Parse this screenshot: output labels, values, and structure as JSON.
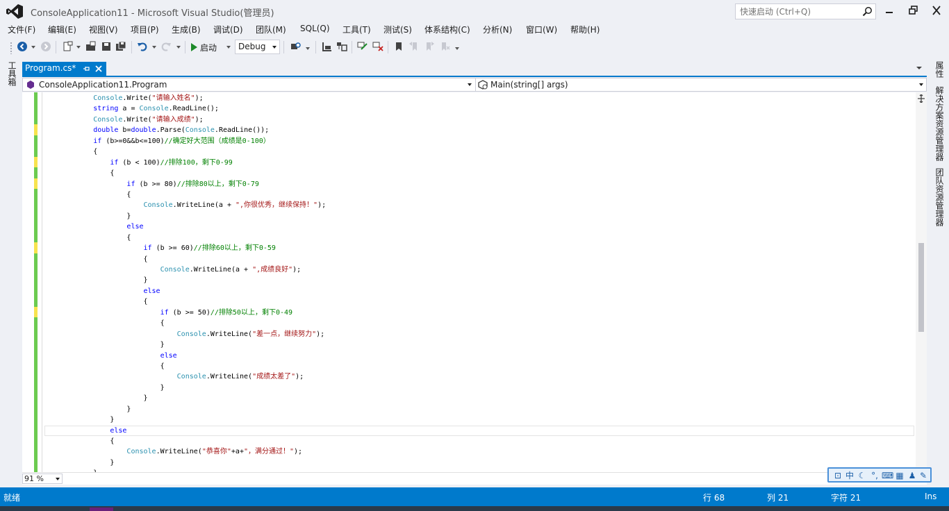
{
  "window": {
    "title": "ConsoleApplication11 - Microsoft Visual Studio(管理员)",
    "quick_launch_placeholder": "快速启动 (Ctrl+Q)"
  },
  "menu": [
    "文件(F)",
    "编辑(E)",
    "视图(V)",
    "项目(P)",
    "生成(B)",
    "调试(D)",
    "团队(M)",
    "SQL(Q)",
    "工具(T)",
    "测试(S)",
    "体系结构(C)",
    "分析(N)",
    "窗口(W)",
    "帮助(H)"
  ],
  "toolbar": {
    "start_label": "启动",
    "config_value": "Debug"
  },
  "left_panel": {
    "toolbox_label": "工具箱"
  },
  "right_panel": {
    "tabs": [
      "属性",
      "解决方案资源管理器",
      "团队资源管理器"
    ]
  },
  "tabs": [
    {
      "label": "Program.cs*",
      "active": true
    }
  ],
  "navbar": {
    "class_dropdown": "ConsoleApplication11.Program",
    "member_dropdown": "Main(string[] args)"
  },
  "code_lines": [
    "            Console.Write(\"请输入姓名\");",
    "            string a = Console.ReadLine();",
    "            Console.Write(\"请输入成绩\");",
    "            double b=double.Parse(Console.ReadLine());",
    "            if (b>=0&&b<=100)//确定好大范围（成绩是0-100）",
    "            {",
    "                if (b < 100)//排除100，剩下0-99",
    "                {",
    "                    if (b >= 80)//排除80以上，剩下0-79",
    "                    {",
    "                        Console.WriteLine(a + \",你很优秀，继续保持！\");",
    "                    }",
    "                    else",
    "                    {",
    "                        if (b >= 60)//排除60以上，剩下0-59",
    "                        {",
    "                            Console.WriteLine(a + \",成绩良好\");",
    "                        }",
    "                        else",
    "                        {",
    "                            if (b >= 50)//排除50以上，剩下0-49",
    "                            {",
    "                                Console.WriteLine(\"差一点，继续努力\");",
    "                            }",
    "                            else",
    "                            {",
    "                                Console.WriteLine(\"成绩太差了\");",
    "                            }",
    "                        }",
    "                    }",
    "                }",
    "                else",
    "                {",
    "                    Console.WriteLine(\"恭喜你\"+a+\"，满分通过！\");",
    "                }",
    "            }"
  ],
  "editor": {
    "zoom": "91 %",
    "current_line_index": 31
  },
  "ime": {
    "mode": "中"
  },
  "status": {
    "ready": "就绪",
    "line": "行 68",
    "col": "列 21",
    "char": "字符 21",
    "ins": "Ins"
  },
  "colors": {
    "accent": "#007acc",
    "keyword": "#0000ff",
    "type": "#2b91af",
    "string": "#a31515",
    "comment": "#008000",
    "change_saved": "#6ccb50",
    "change_unsaved": "#f7e34f"
  }
}
